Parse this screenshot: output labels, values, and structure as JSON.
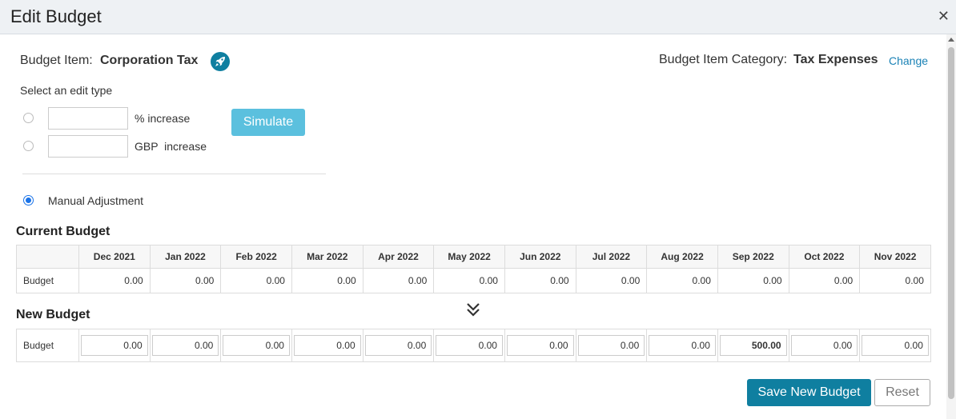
{
  "modal": {
    "title": "Edit Budget",
    "close_glyph": "✕"
  },
  "budget_item": {
    "label": "Budget Item:",
    "value": "Corporation Tax",
    "icon": "rocket-icon"
  },
  "category": {
    "label": "Budget Item Category:",
    "value": "Tax Expenses",
    "change_label": "Change"
  },
  "edit_type": {
    "heading": "Select an edit type",
    "percent_label": "% increase",
    "gbp_label": "GBP  increase",
    "simulate_label": "Simulate",
    "manual_label": "Manual Adjustment",
    "selected": "manual"
  },
  "months": [
    "Dec 2021",
    "Jan 2022",
    "Feb 2022",
    "Mar 2022",
    "Apr 2022",
    "May 2022",
    "Jun 2022",
    "Jul 2022",
    "Aug 2022",
    "Sep 2022",
    "Oct 2022",
    "Nov 2022"
  ],
  "current_budget": {
    "title": "Current Budget",
    "row_label": "Budget",
    "values": [
      "0.00",
      "0.00",
      "0.00",
      "0.00",
      "0.00",
      "0.00",
      "0.00",
      "0.00",
      "0.00",
      "0.00",
      "0.00",
      "0.00"
    ]
  },
  "new_budget": {
    "title": "New Budget",
    "row_label": "Budget",
    "values": [
      "0.00",
      "0.00",
      "0.00",
      "0.00",
      "0.00",
      "0.00",
      "0.00",
      "0.00",
      "0.00",
      "500.00",
      "0.00",
      "0.00"
    ]
  },
  "actions": {
    "save_label": "Save New Budget",
    "reset_label": "Reset"
  },
  "colors": {
    "primary": "#0f7fa0",
    "simulate": "#5bc0de",
    "link": "#1a82b6",
    "radio": "#1a73e8"
  }
}
